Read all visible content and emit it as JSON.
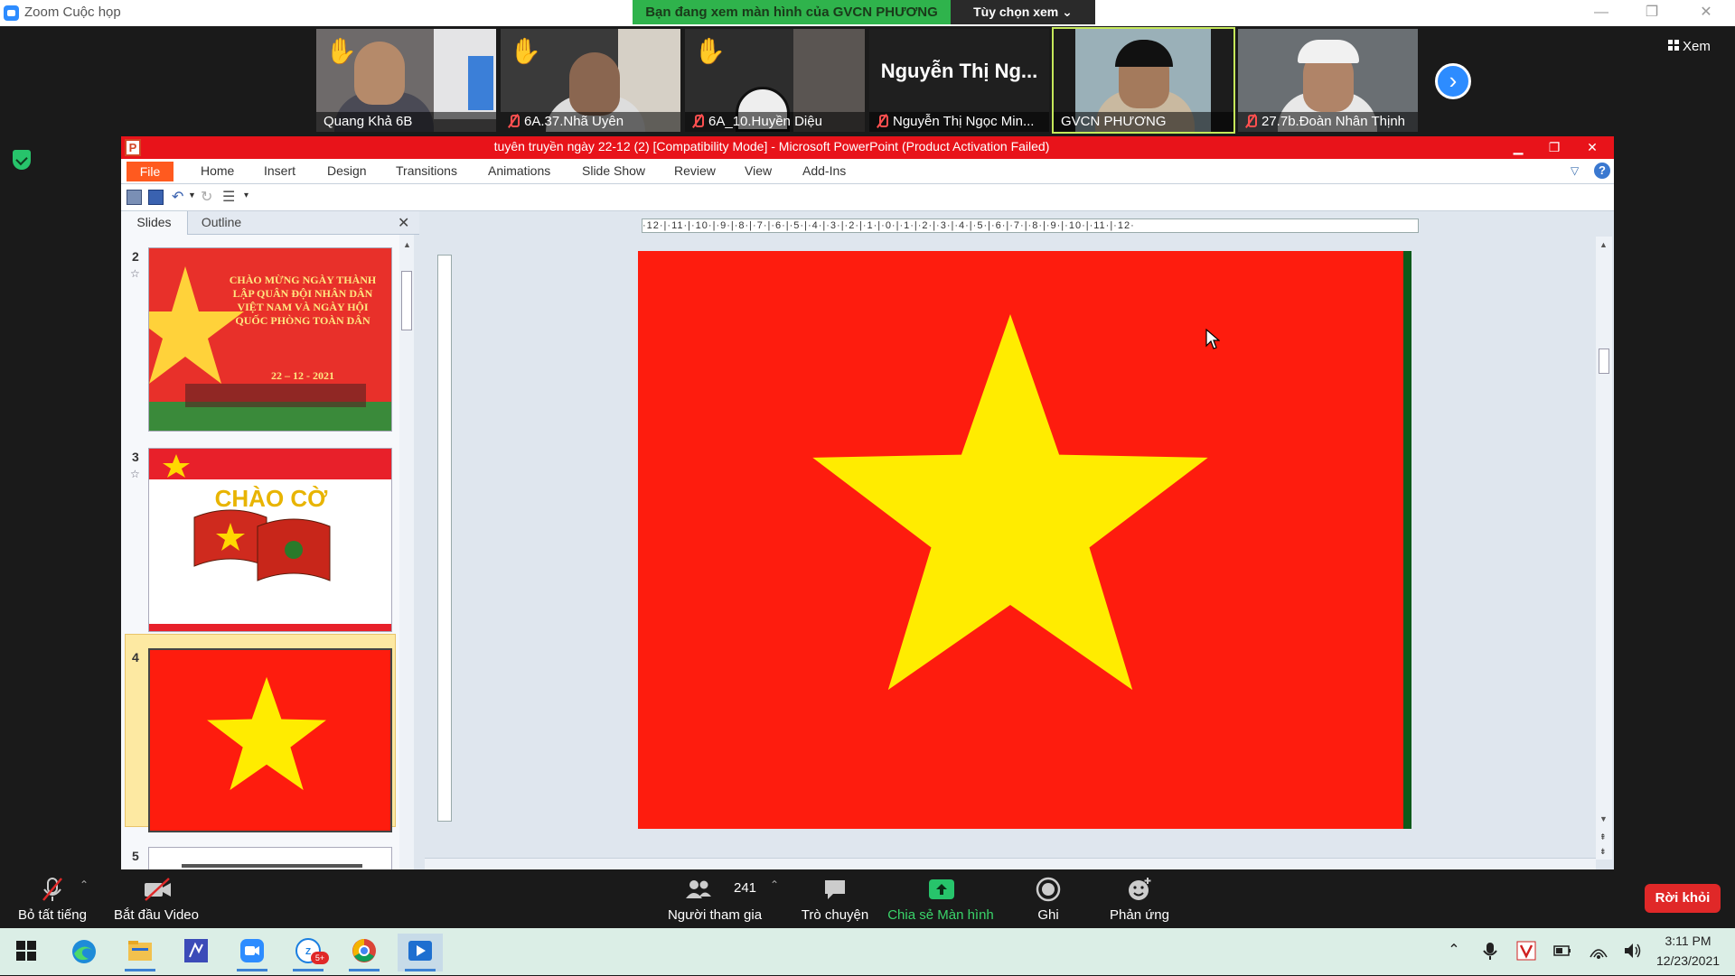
{
  "zoom": {
    "window_title": "Zoom Cuộc họp",
    "share_banner": "Bạn đang xem màn hình của GVCN PHƯƠNG",
    "view_options": "Tùy chọn xem",
    "view_button": "Xem"
  },
  "gallery": [
    {
      "name": "Quang Khả 6B",
      "hand_raised": true,
      "muted": false
    },
    {
      "name": "6A.37.Nhã Uyên",
      "hand_raised": true,
      "muted": true
    },
    {
      "name": "6A_10.Huyền Diệu",
      "hand_raised": true,
      "muted": true
    },
    {
      "name": "Nguyễn Thị Ngọc Min...",
      "display_name": "Nguyễn Thị Ng...",
      "hand_raised": false,
      "muted": true
    },
    {
      "name": "GVCN PHƯƠNG",
      "hand_raised": false,
      "muted": false,
      "active_speaker": true
    },
    {
      "name": "27.7b.Đoàn Nhân Thịnh",
      "hand_raised": false,
      "muted": true
    }
  ],
  "ppt": {
    "title": "tuyên truyền ngày 22-12  (2) [Compatibility Mode]  -  Microsoft PowerPoint (Product Activation Failed)",
    "tabs": [
      "File",
      "Home",
      "Insert",
      "Design",
      "Transitions",
      "Animations",
      "Slide Show",
      "Review",
      "View",
      "Add-Ins"
    ],
    "pane_tabs": {
      "slides": "Slides",
      "outline": "Outline"
    },
    "slide_numbers": [
      "2",
      "3",
      "4",
      "5"
    ],
    "thumb2_text": [
      "CHÀO MỪNG NGÀY THÀNH",
      "LẬP QUÂN ĐỘI NHÂN DÂN",
      "VIỆT NAM VÀ NGÀY HỘI",
      "QUỐC PHÒNG TOÀN DÂN"
    ],
    "thumb2_date": "22 – 12 - 2021",
    "thumb3_text": "CHÀO CỜ",
    "ruler_text": "·12·|·11·|·10·|·9·|·8·|·7·|·6·|·5·|·4·|·3·|·2·|·1·|·0·|·1·|·2·|·3·|·4·|·5·|·6·|·7·|·8·|·9·|·10·|·11·|·12·",
    "current_slide": 4,
    "flag_red": "#fe1c0e",
    "flag_yellow": "#ffec00"
  },
  "toolbar": {
    "mute_all": "Bỏ tất tiếng",
    "start_video": "Bắt đầu Video",
    "participants_count": "241",
    "participants": "Người tham gia",
    "chat": "Trò chuyện",
    "share_screen": "Chia sẻ Màn hình",
    "record": "Ghi",
    "reactions": "Phản ứng",
    "leave": "Rời khỏi"
  },
  "taskbar": {
    "time": "3:11 PM",
    "date": "12/23/2021",
    "zalo_badge": "5+"
  }
}
